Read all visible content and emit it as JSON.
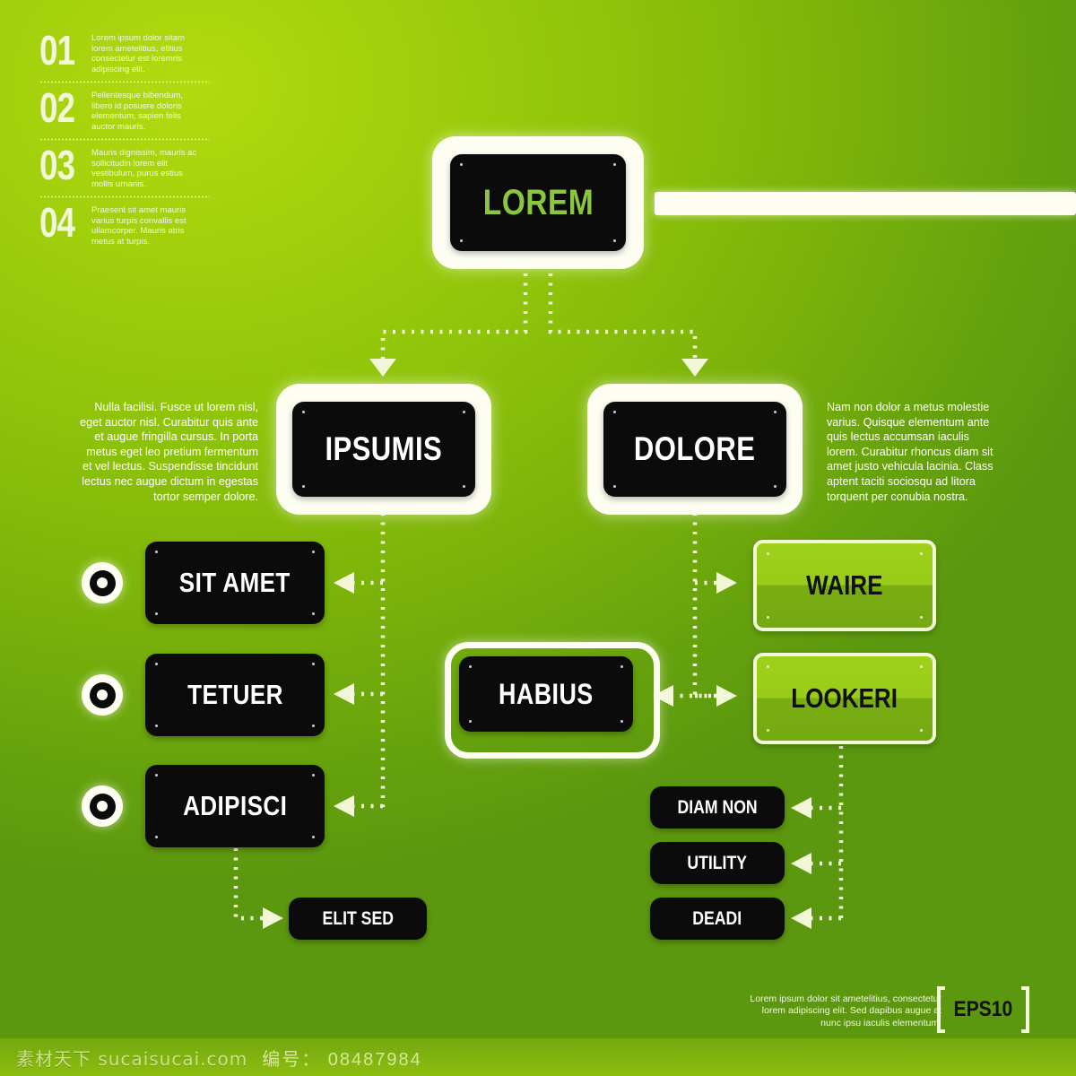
{
  "numbered_list": [
    {
      "num": "01",
      "text": "Lorem ipsum dolor sitam lorem ametelitius, elitius consectetur est loremris adipiscing elit."
    },
    {
      "num": "02",
      "text": "Pellentesque bibendum, libero id posuere doloris elementum, sapien felis auctor mauris."
    },
    {
      "num": "03",
      "text": "Mauris dignissim, mauris ac sollicitudin lorem elit vestibulum, purus estius mollis urnanis."
    },
    {
      "num": "04",
      "text": "Praesent sit amet mauris varius turpis convallis est ullamcorper. Mauris atris metus at turpis."
    }
  ],
  "paragraphs": {
    "left": "Nulla facilisi. Fusce ut lorem nisl, eget auctor nisl. Curabitur quis ante et augue fringilla cursus. In porta metus eget leo pretium fermentum et vel lectus. Suspendisse tincidunt lectus nec augue dictum in egestas tortor semper dolore.",
    "right": "Nam non dolor a metus molestie varius. Quisque elementum ante quis lectus accumsan iaculis lorem. Curabitur rhoncus diam sit amet justo vehicula lacinia. Class aptent taciti sociosqu ad litora torquent per conubia nostra."
  },
  "nodes": {
    "root": "LOREM",
    "branch_left": "IPSUMIS",
    "branch_right": "DOLORE",
    "left_items": [
      "SIT AMET",
      "TETUER",
      "ADIPISCI"
    ],
    "left_sub": "ELIT SED",
    "center": "HABIUS",
    "right_items": [
      "WAIRE",
      "LOOKERI"
    ],
    "right_sub": [
      "DIAM NON",
      "UTILITY",
      "DEADI"
    ]
  },
  "footer": {
    "text": "Lorem ipsum dolor sit ametelitius, consectetur lorem adipiscing elit. Sed dapibus augue at nunc ipsu iaculis elementum.",
    "badge": "EPS10"
  },
  "watermark": {
    "site": "素材天下 sucaisucai.com",
    "id": "编号： 08487984"
  },
  "colors": {
    "accent_green": "#8cc63e",
    "plate_black": "#0b0b0b",
    "cream": "#fdfdf2",
    "bg_light": "#b3da10",
    "bg_dark": "#5b970f"
  }
}
